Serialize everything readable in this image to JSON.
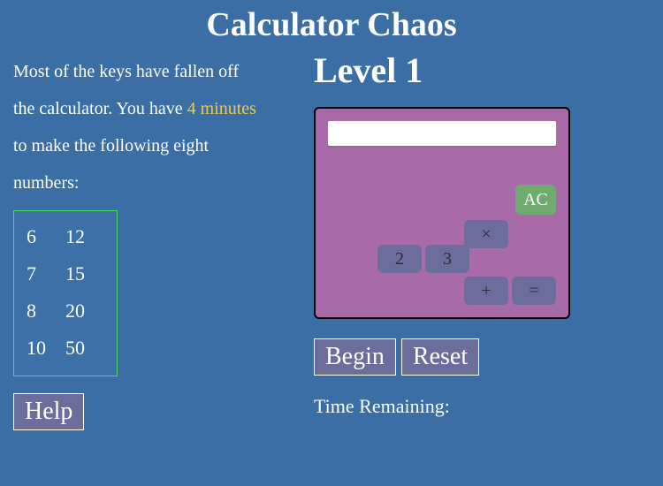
{
  "title": "Calculator Chaos",
  "instructions": {
    "pre": "Most of the keys have fallen off the calculator. You have ",
    "time": "4 minutes",
    "post": " to make the following eight numbers:"
  },
  "targets": [
    [
      "6",
      "12"
    ],
    [
      "7",
      "15"
    ],
    [
      "8",
      "20"
    ],
    [
      "10",
      "50"
    ]
  ],
  "help_label": "Help",
  "level_label": "Level 1",
  "keys": {
    "ac": "AC",
    "times": "×",
    "two": "2",
    "three": "3",
    "plus": "+",
    "eq": "="
  },
  "begin_label": "Begin",
  "reset_label": "Reset",
  "time_remaining_label": "Time Remaining:",
  "time_remaining_value": ""
}
